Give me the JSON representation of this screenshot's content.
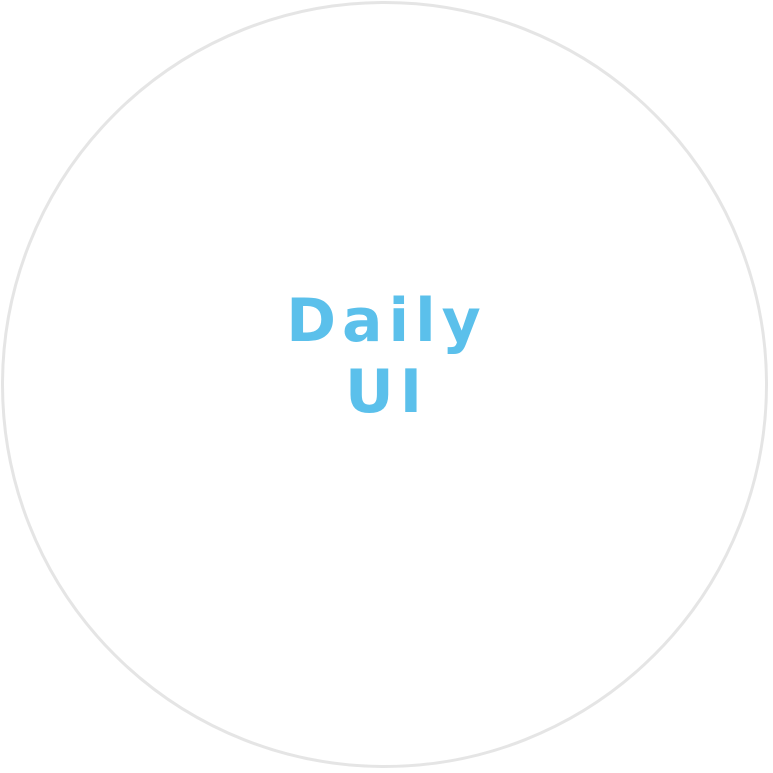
{
  "logo": {
    "line1": "Daily",
    "line2": "UI"
  },
  "colors": {
    "text": "#5bc0eb",
    "ring": "#e5e5e5",
    "background": "#ffffff"
  }
}
